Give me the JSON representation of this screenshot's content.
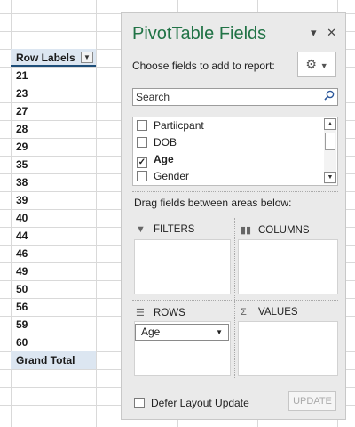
{
  "pivot_table": {
    "header": "Row Labels",
    "rows": [
      "21",
      "23",
      "27",
      "28",
      "29",
      "35",
      "38",
      "39",
      "40",
      "44",
      "46",
      "49",
      "50",
      "56",
      "59",
      "60"
    ],
    "total_label": "Grand Total"
  },
  "panel": {
    "title": "PivotTable Fields",
    "pin_icon": "dropdown-arrow",
    "close_icon": "close-x",
    "choose_label": "Choose fields to add to report:",
    "gear_icon": "gear",
    "search": {
      "value": "Search",
      "icon": "magnifier"
    },
    "fields": [
      {
        "label": "Partiicpant",
        "checked": false
      },
      {
        "label": "DOB",
        "checked": false
      },
      {
        "label": "Age",
        "checked": true
      },
      {
        "label": "Gender",
        "checked": false
      }
    ],
    "drag_label": "Drag fields between areas below:",
    "areas": {
      "filters": {
        "label": "FILTERS",
        "icon": "funnel"
      },
      "columns": {
        "label": "COLUMNS",
        "icon": "columns-bars"
      },
      "rows": {
        "label": "ROWS",
        "icon": "rows-lines",
        "items": [
          "Age"
        ]
      },
      "values": {
        "label": "VALUES",
        "icon": "sigma"
      }
    },
    "defer_label": "Defer Layout Update",
    "update_label": "UPDATE"
  },
  "colors": {
    "accent": "#217346",
    "header_fill": "#dce6f1",
    "grid": "#d9d9d9"
  }
}
